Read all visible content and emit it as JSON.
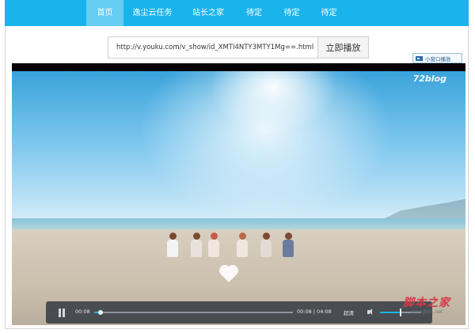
{
  "nav": {
    "items": [
      {
        "label": "首页",
        "active": true
      },
      {
        "label": "逸尘云任务",
        "active": false
      },
      {
        "label": "站长之家",
        "active": false
      },
      {
        "label": "待定",
        "active": false
      },
      {
        "label": "待定",
        "active": false
      },
      {
        "label": "待定",
        "active": false
      }
    ]
  },
  "player": {
    "url_value": "http://v.youku.com/v_show/id_XMTI4NTY3MTY1Mg==.html",
    "play_button": "立即播放",
    "mini_window_button": "小窗口播放",
    "video_watermark": "72blog"
  },
  "controls": {
    "current_time": "00:08",
    "time_display": "00:08 | 04:08",
    "quality": "超清",
    "progress_fraction": 0.032,
    "volume_fraction": 0.5
  },
  "site_watermark": {
    "text": "脚本之家",
    "url": "www.jb51.net"
  },
  "colors": {
    "nav_bg": "#1ab4ec",
    "nav_active": "#66cdf3",
    "progress": "#1ab4ec"
  }
}
